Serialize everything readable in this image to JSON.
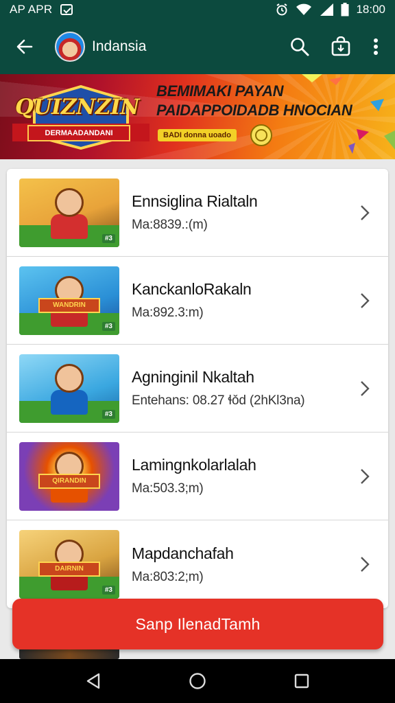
{
  "status_bar": {
    "app_name": "AP APR",
    "time": "18:00",
    "icons": [
      "notification-icon",
      "alarm-icon",
      "wifi-icon",
      "signal-icon",
      "battery-icon"
    ]
  },
  "app_bar": {
    "title": "Indansia",
    "icons": [
      "back-arrow-icon",
      "search-icon",
      "bag-icon",
      "more-vertical-icon"
    ]
  },
  "banner": {
    "logo_title": "QUIZNZIN",
    "logo_subtitle": "DERMAADANDANI",
    "headline_1": "BEMIMAKI PAYAN",
    "headline_2": "PAIDAPPOIDADB HNOCIAN",
    "headline_3": "BADI donna uoado"
  },
  "items": [
    {
      "name": "Ennsiglina Rialtaln",
      "meta": "Ma:8839.:(m)",
      "sky": "#e8a33a",
      "shirt": "#d32f2f",
      "tag": "#3"
    },
    {
      "name": "KanckanloRakaln",
      "meta": "Ma:892.3:m)",
      "sky": "#2a8fd6",
      "shirt": "#c62828",
      "tag": "#3",
      "plaque": "WANDRIN"
    },
    {
      "name": "Agninginil Nkaltah",
      "meta": "Entehans: 08.27 ɬǒd (2hKl3na)",
      "sky": "#3aa7e0",
      "shirt": "#1565c0",
      "tag": "#3"
    },
    {
      "name": "Lamingnkolarlalah",
      "meta": "Ma:503.3;m)",
      "sky": "#7b3fb5",
      "shirt": "#e65100",
      "tag": "",
      "plaque": "QIRANDIN"
    },
    {
      "name": "Mapdanchafah",
      "meta": "Ma:803:2;m)",
      "sky": "#d9a441",
      "shirt": "#b71c1c",
      "tag": "#3",
      "plaque": "DAIRNIN"
    }
  ],
  "cta": {
    "label": "Sanp IlenadTamh"
  },
  "nav_bar": {
    "icons": [
      "nav-back-icon",
      "nav-home-icon",
      "nav-recents-icon"
    ]
  }
}
